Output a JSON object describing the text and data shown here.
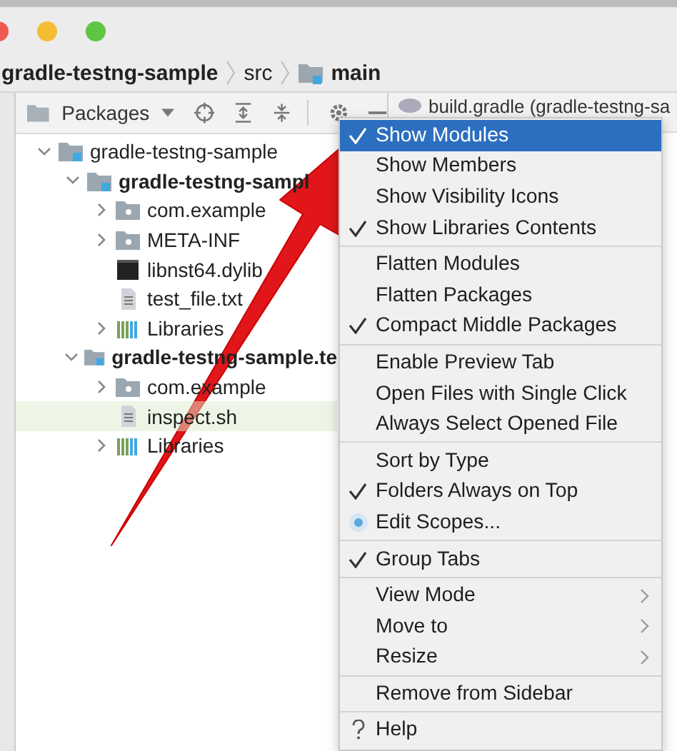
{
  "breadcrumb": [
    {
      "label": "gradle-testng-sample",
      "kind": "plain"
    },
    {
      "label": "src",
      "kind": "plain"
    },
    {
      "label": "main",
      "kind": "folder"
    }
  ],
  "toolbar": {
    "view": "Packages"
  },
  "editor_tab": "build.gradle (gradle-testng-sa",
  "tree": [
    {
      "label": "gradle-testng-sample",
      "kind": "module",
      "expanded": true,
      "bold": false,
      "selected": false,
      "children": [
        {
          "label": "gradle-testng-sampl",
          "kind": "module",
          "expanded": true,
          "bold": true,
          "selected": false,
          "children": [
            {
              "label": "com.example",
              "kind": "folder",
              "expanded": false,
              "bold": false,
              "selected": false
            },
            {
              "label": "META-INF",
              "kind": "folder",
              "expanded": false,
              "bold": false,
              "selected": false
            },
            {
              "label": "libnst64.dylib",
              "kind": "binary",
              "bold": false,
              "selected": false
            },
            {
              "label": "test_file.txt",
              "kind": "file",
              "bold": false,
              "selected": false
            },
            {
              "label": "Libraries",
              "kind": "library",
              "expanded": false,
              "bold": false,
              "selected": false
            }
          ]
        },
        {
          "label": "gradle-testng-sample.te",
          "kind": "module",
          "expanded": true,
          "bold": true,
          "selected": false,
          "children": [
            {
              "label": "com.example",
              "kind": "folder",
              "expanded": false,
              "bold": false,
              "selected": false
            },
            {
              "label": "inspect.sh",
              "kind": "file",
              "bold": false,
              "selected": true
            },
            {
              "label": "Libraries",
              "kind": "library",
              "expanded": false,
              "bold": false,
              "selected": false
            }
          ]
        }
      ]
    }
  ],
  "menu": [
    [
      {
        "label": "Show Modules",
        "kind": "check",
        "checked": true,
        "selected": true
      },
      {
        "label": "Show Members",
        "kind": "check",
        "checked": false,
        "selected": false
      },
      {
        "label": "Show Visibility Icons",
        "kind": "check",
        "checked": false,
        "selected": false
      },
      {
        "label": "Show Libraries Contents",
        "kind": "check",
        "checked": true,
        "selected": false
      }
    ],
    [
      {
        "label": "Flatten Modules",
        "kind": "check",
        "checked": false,
        "selected": false
      },
      {
        "label": "Flatten Packages",
        "kind": "check",
        "checked": false,
        "selected": false
      },
      {
        "label": "Compact Middle Packages",
        "kind": "check",
        "checked": true,
        "selected": false
      }
    ],
    [
      {
        "label": "Enable Preview Tab",
        "kind": "check",
        "checked": false,
        "selected": false
      },
      {
        "label": "Open Files with Single Click",
        "kind": "check",
        "checked": false,
        "selected": false
      },
      {
        "label": "Always Select Opened File",
        "kind": "check",
        "checked": false,
        "selected": false
      }
    ],
    [
      {
        "label": "Sort by Type",
        "kind": "check",
        "checked": false,
        "selected": false
      },
      {
        "label": "Folders Always on Top",
        "kind": "check",
        "checked": true,
        "selected": false
      },
      {
        "label": "Edit Scopes...",
        "kind": "radio",
        "checked": true,
        "selected": false
      }
    ],
    [
      {
        "label": "Group Tabs",
        "kind": "check",
        "checked": true,
        "selected": false
      }
    ],
    [
      {
        "label": "View Mode",
        "kind": "submenu",
        "selected": false
      },
      {
        "label": "Move to",
        "kind": "submenu",
        "selected": false
      },
      {
        "label": "Resize",
        "kind": "submenu",
        "selected": false
      }
    ],
    [
      {
        "label": "Remove from Sidebar",
        "kind": "check",
        "checked": false,
        "selected": false
      }
    ],
    [
      {
        "label": "Help",
        "kind": "help",
        "selected": false
      }
    ]
  ]
}
